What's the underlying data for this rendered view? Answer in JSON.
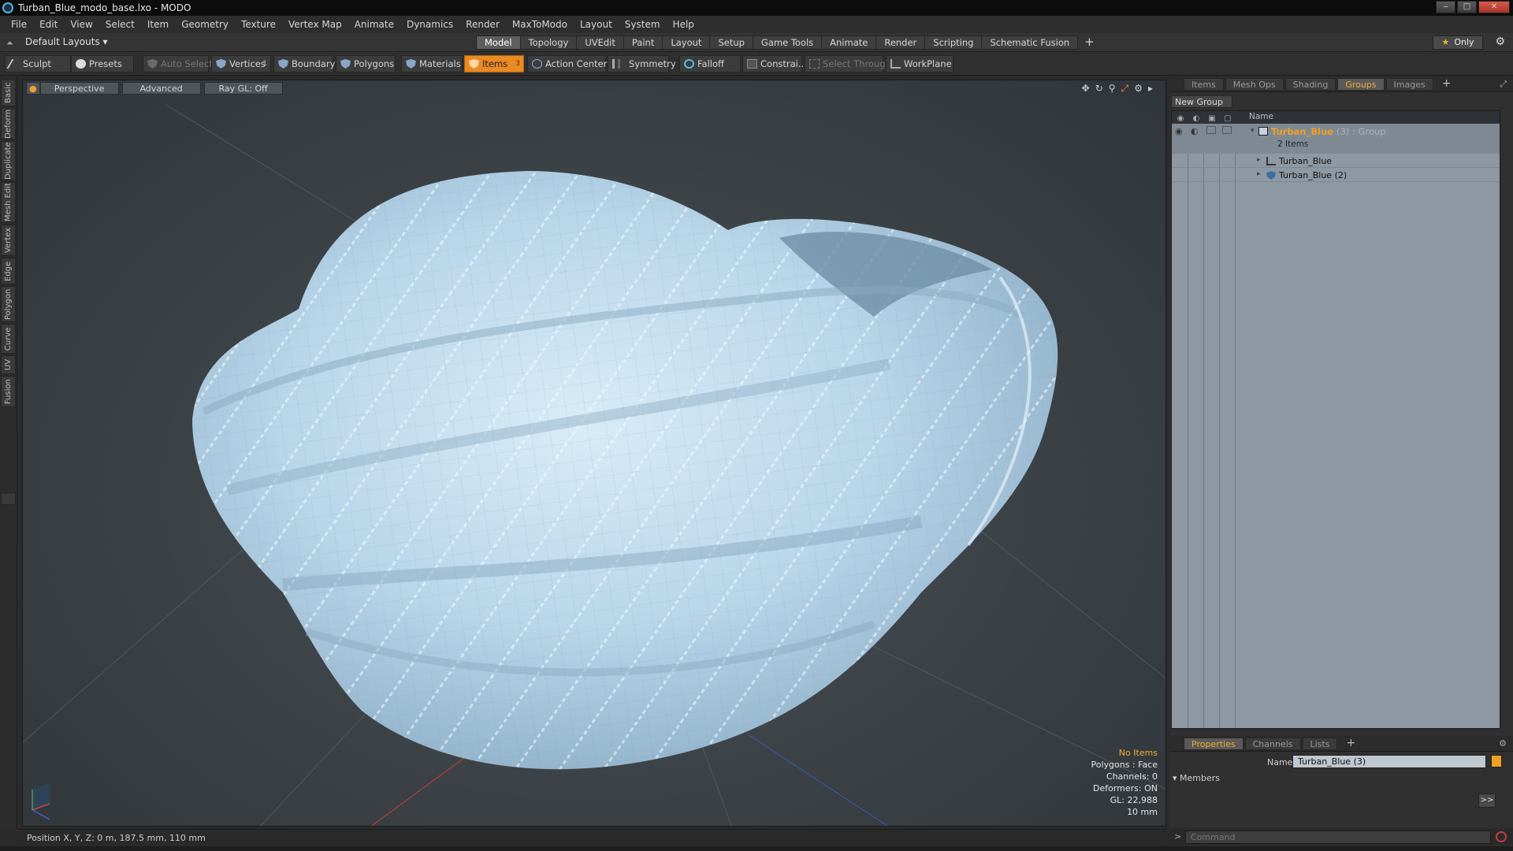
{
  "window": {
    "title": "Turban_Blue_modo_base.lxo - MODO",
    "minimize": "‒",
    "maximize": "□",
    "close": "✕"
  },
  "menubar": [
    "File",
    "Edit",
    "View",
    "Select",
    "Item",
    "Geometry",
    "Texture",
    "Vertex Map",
    "Animate",
    "Dynamics",
    "Render",
    "MaxToModo",
    "Layout",
    "System",
    "Help"
  ],
  "layoutbar": {
    "layouts_dropdown": "Default Layouts ▾",
    "tabs": [
      "Model",
      "Topology",
      "UVEdit",
      "Paint",
      "Layout",
      "Setup",
      "Game Tools",
      "Animate",
      "Render",
      "Scripting",
      "Schematic Fusion"
    ],
    "active_tab": "Model",
    "add_tab": "+",
    "only_label": "Only"
  },
  "toolbar": {
    "sculpt": "Sculpt",
    "presets": "Presets",
    "auto_select": "Auto Select",
    "vertices": "Vertices",
    "vertices_count": "1",
    "boundary": "Boundary",
    "polygons": "Polygons",
    "materials": "Materials",
    "items": "Items",
    "items_count": "3",
    "action_center": "Action Center",
    "symmetry": "Symmetry",
    "falloff": "Falloff",
    "constraint": "Constrai...",
    "select_through": "Select Through",
    "workplane": "WorkPlane"
  },
  "left_tabs": [
    "Basic",
    "Deform",
    "Duplicate",
    "Mesh Edit",
    "Vertex",
    "Edge",
    "Polygon",
    "Curve",
    "UV",
    "Fusion"
  ],
  "viewport": {
    "view_mode": "Perspective",
    "shading": "Advanced",
    "raygl": "Ray GL: Off",
    "info": {
      "selection": "No Items",
      "polygons": "Polygons : Face",
      "channels": "Channels: 0",
      "deformers": "Deformers: ON",
      "gl": "GL: 22,988",
      "unit": "10 mm"
    }
  },
  "status": {
    "position": "Position X, Y, Z:  0 m, 187.5 mm, 110 mm"
  },
  "right_panel": {
    "top_tabs": [
      "Items",
      "Mesh Ops",
      "Shading",
      "Groups",
      "Images"
    ],
    "active_top_tab": "Groups",
    "new_group": "New Group",
    "list_header_name": "Name",
    "group": {
      "name": "Turban_Blue",
      "suffix": "(3) : Group",
      "count": "2 Items",
      "children": [
        {
          "name": "Turban_Blue",
          "icon": "mesh-icon"
        },
        {
          "name": "Turban_Blue (2)",
          "icon": "locator-icon"
        }
      ]
    },
    "props_tabs": [
      "Properties",
      "Channels",
      "Lists"
    ],
    "active_props_tab": "Properties",
    "name_label": "Name",
    "name_value": "Turban_Blue (3)",
    "members_label": "Members",
    "members_button": ">>",
    "command_placeholder": "Command"
  },
  "colors": {
    "accent_orange": "#e98a23",
    "group_name": "#f0a020",
    "mesh_fill": "#bcdaee"
  }
}
